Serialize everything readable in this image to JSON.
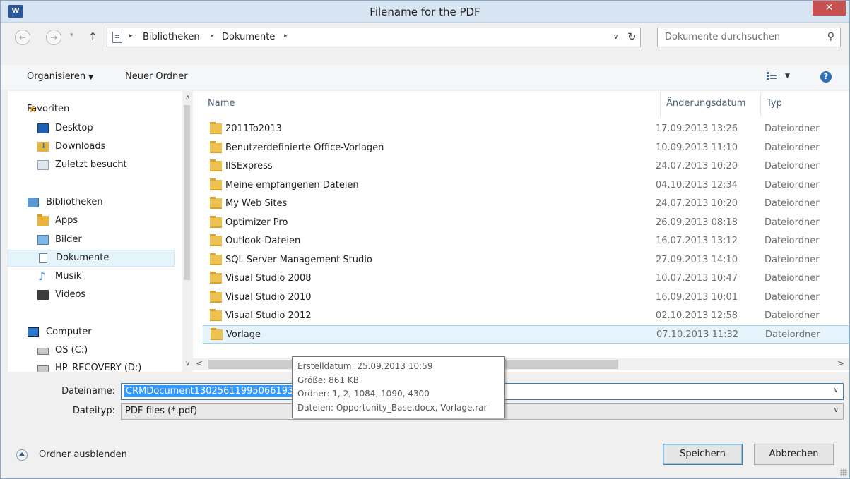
{
  "window": {
    "app_icon": "W",
    "title": "Filename for the PDF",
    "close_glyph": "✕"
  },
  "navigation": {
    "back_glyph": "←",
    "forward_glyph": "→",
    "dropdown_glyph": "▾",
    "up_glyph": "↑",
    "breadcrumbs": [
      "Bibliotheken",
      "Dokumente"
    ],
    "breadcrumb_sep": "▸",
    "address_dropdown_glyph": "∨",
    "refresh_glyph": "↻",
    "search_placeholder": "Dokumente durchsuchen",
    "search_glyph": "⚲"
  },
  "toolbar": {
    "organize_label": "Organisieren",
    "organize_caret": "▼",
    "new_folder_label": "Neuer Ordner",
    "view_caret": "▼",
    "help_glyph": "?"
  },
  "sidebar": {
    "scroll_up": "∧",
    "scroll_down": "∨",
    "favorites": {
      "label": "Favoriten",
      "items": [
        {
          "label": "Desktop",
          "icon": "desktop-icon"
        },
        {
          "label": "Downloads",
          "icon": "downloads-icon"
        },
        {
          "label": "Zuletzt besucht",
          "icon": "recent-places-icon"
        }
      ]
    },
    "libraries": {
      "label": "Bibliotheken",
      "items": [
        {
          "label": "Apps",
          "icon": "folder-icon"
        },
        {
          "label": "Bilder",
          "icon": "pictures-icon"
        },
        {
          "label": "Dokumente",
          "icon": "documents-icon",
          "selected": true
        },
        {
          "label": "Musik",
          "icon": "music-icon"
        },
        {
          "label": "Videos",
          "icon": "videos-icon"
        }
      ]
    },
    "computer": {
      "label": "Computer",
      "items": [
        {
          "label": "OS (C:)",
          "icon": "drive-icon"
        },
        {
          "label": "HP_RECOVERY (D:)",
          "icon": "drive-icon"
        }
      ]
    }
  },
  "file_list": {
    "columns": {
      "name": "Name",
      "modified": "Änderungsdatum",
      "type": "Typ",
      "sort_indicator": "^"
    },
    "rows": [
      {
        "name": "2011To2013",
        "date": "17.09.2013 13:26",
        "type": "Dateiordner"
      },
      {
        "name": "Benutzerdefinierte Office-Vorlagen",
        "date": "10.09.2013 11:10",
        "type": "Dateiordner"
      },
      {
        "name": "IISExpress",
        "date": "24.07.2013 10:20",
        "type": "Dateiordner"
      },
      {
        "name": "Meine empfangenen Dateien",
        "date": "04.10.2013 12:34",
        "type": "Dateiordner"
      },
      {
        "name": "My Web Sites",
        "date": "24.07.2013 10:20",
        "type": "Dateiordner"
      },
      {
        "name": "Optimizer Pro",
        "date": "26.09.2013 08:18",
        "type": "Dateiordner"
      },
      {
        "name": "Outlook-Dateien",
        "date": "16.07.2013 13:12",
        "type": "Dateiordner"
      },
      {
        "name": "SQL Server Management Studio",
        "date": "27.09.2013 14:10",
        "type": "Dateiordner"
      },
      {
        "name": "Visual Studio 2008",
        "date": "10.07.2013 10:47",
        "type": "Dateiordner"
      },
      {
        "name": "Visual Studio 2010",
        "date": "16.09.2013 10:01",
        "type": "Dateiordner"
      },
      {
        "name": "Visual Studio 2012",
        "date": "02.10.2013 12:58",
        "type": "Dateiordner"
      },
      {
        "name": "Vorlage",
        "date": "07.10.2013 11:32",
        "type": "Dateiordner",
        "selected": true
      }
    ],
    "scroll_left": "<",
    "scroll_right": ">"
  },
  "tooltip": {
    "lines": [
      "Erstelldatum: 25.09.2013 10:59",
      "Größe: 861 KB",
      "Ordner: 1, 2, 1084, 1090, 4300",
      "Dateien: Opportunity_Base.docx, Vorlage.rar"
    ]
  },
  "form": {
    "filename_label": "Dateiname:",
    "filename_value": "CRMDocument13025611995066193",
    "filetype_label": "Dateityp:",
    "filetype_value": "PDF files (*.pdf)",
    "dropdown_glyph": "∨"
  },
  "footer": {
    "hide_folders_label": "Ordner ausblenden",
    "save_label": "Speichern",
    "cancel_label": "Abbrechen"
  }
}
